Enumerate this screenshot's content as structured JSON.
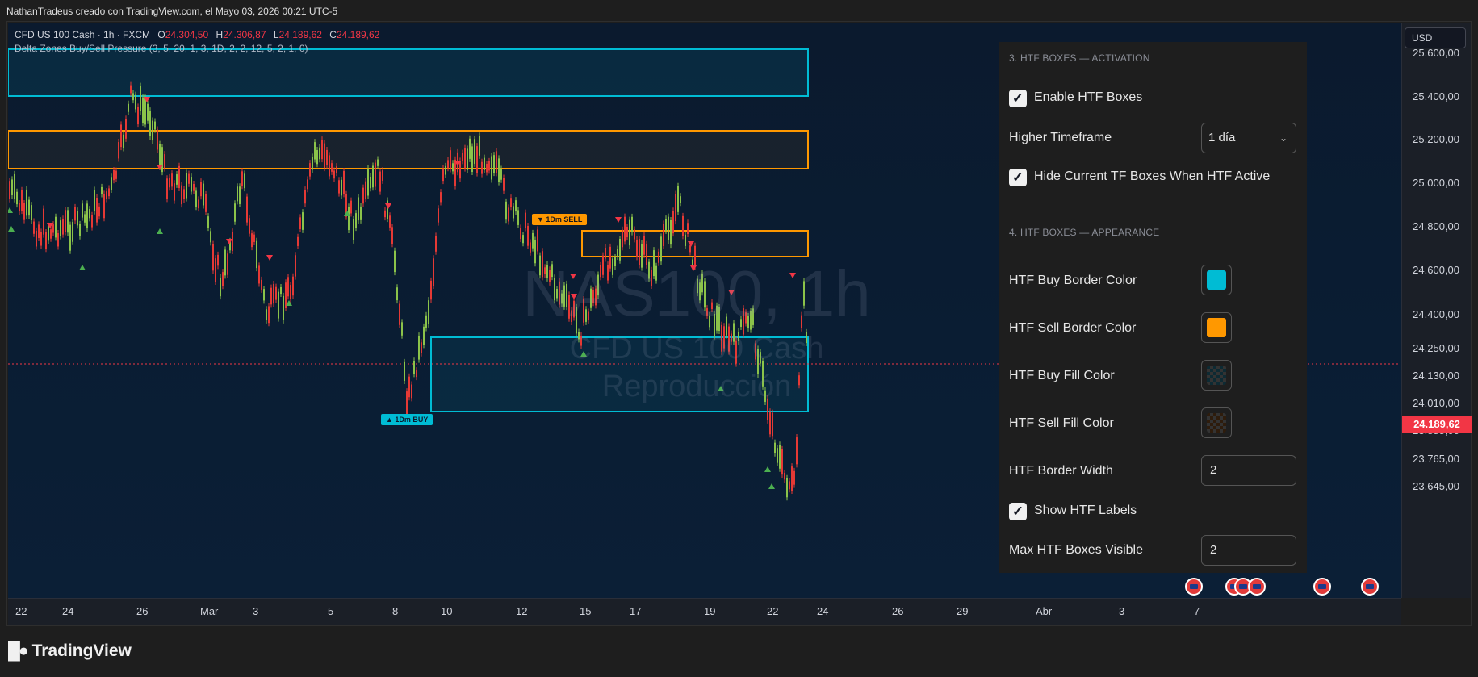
{
  "caption": "NathanTradeus creado con TradingView.com, el Mayo 03, 2026 00:21 UTC-5",
  "legend": {
    "symbol": "CFD US 100 Cash · 1h · FXCM",
    "o_label": "O",
    "o_value": "24.304,50",
    "h_label": "H",
    "h_value": "24.306,87",
    "l_label": "L",
    "l_value": "24.189,62",
    "c_label": "C",
    "c_value": "24.189,62",
    "indicator": "Delta Zones Buy/Sell Pressure (3, 5, 20, 1, 3, 1D, 2, 2, 12, 5, 2, 1, 0)"
  },
  "watermark": {
    "line1": "NAS100, 1h",
    "line2": "CFD US 100 Cash",
    "line3": "Reproducción"
  },
  "zones": {
    "sell_label": "▼ 1Dm SELL",
    "buy_label": "▲ 1Dm BUY"
  },
  "price_axis": {
    "currency": "USD",
    "ticks": [
      "25.600,00",
      "25.400,00",
      "25.200,00",
      "25.000,00",
      "24.800,00",
      "24.600,00",
      "24.400,00",
      "24.250,00",
      "24.130,00",
      "24.010,00",
      "23.885,00",
      "23.765,00",
      "23.645,00"
    ],
    "current_price": "24.189,62"
  },
  "time_axis": {
    "ticks": [
      "22",
      "24",
      "26",
      "Mar",
      "3",
      "5",
      "8",
      "10",
      "12",
      "15",
      "17",
      "19",
      "22",
      "24",
      "26",
      "29",
      "Abr",
      "3",
      "7"
    ]
  },
  "settings": {
    "section3_title": "3. HTF BOXES — ACTIVATION",
    "enable_htf_label": "Enable HTF Boxes",
    "enable_htf_checked": true,
    "higher_tf_label": "Higher Timeframe",
    "higher_tf_value": "1 día",
    "hide_current_label": "Hide Current TF Boxes When HTF Active",
    "hide_current_checked": true,
    "section4_title": "4. HTF BOXES — APPEARANCE",
    "buy_border_label": "HTF Buy Border Color",
    "buy_border_color": "#00bcd4",
    "sell_border_label": "HTF Sell Border Color",
    "sell_border_color": "#ff9800",
    "buy_fill_label": "HTF Buy Fill Color",
    "sell_fill_label": "HTF Sell Fill Color",
    "border_width_label": "HTF Border Width",
    "border_width_value": "2",
    "show_labels_label": "Show HTF Labels",
    "show_labels_checked": true,
    "max_boxes_label": "Max HTF Boxes Visible",
    "max_boxes_value": "2"
  },
  "brand": "TradingView",
  "colors": {
    "up_candle": "#26a69a",
    "down_candle": "#ef5350",
    "buy_zone": "#00bcd4",
    "sell_zone": "#ff9800",
    "price_red": "#f23645"
  }
}
